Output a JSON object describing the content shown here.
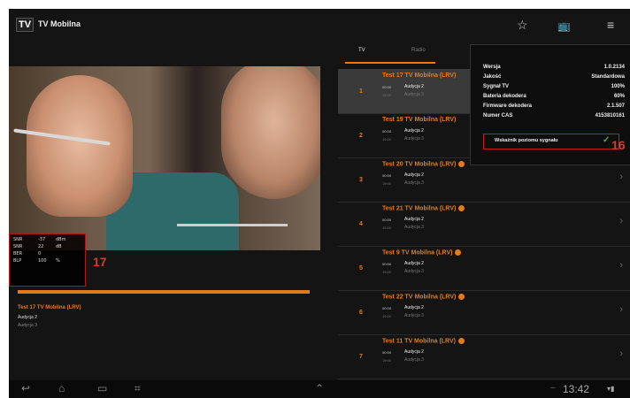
{
  "app": {
    "logo": "TV",
    "title": "TV Mobilna"
  },
  "actionbar": {
    "icons": [
      "star-icon",
      "tv-icon",
      "menu-icon"
    ]
  },
  "video": {
    "signal": {
      "rows": [
        {
          "label": "SNR",
          "value": "-37",
          "unit": "dBm"
        },
        {
          "label": "SNR",
          "value": "22",
          "unit": "dB"
        },
        {
          "label": "BER",
          "value": "0",
          "unit": ""
        },
        {
          "label": "BLP",
          "value": "100",
          "unit": "%"
        }
      ]
    },
    "progress": {
      "fraction": 1.0
    },
    "now_playing": {
      "title": "Test 17 TV Mobilna (LRV)",
      "line1": "Audycja 2",
      "line2": "Audycja 3"
    }
  },
  "annotations": {
    "label17": "17",
    "label16": "16"
  },
  "tabs": [
    {
      "label": "TV"
    },
    {
      "label": "Radio"
    }
  ],
  "channels": [
    {
      "num": "1",
      "name": "Test 17 TV Mobilna (LRV)",
      "badge": false,
      "time": "00:00",
      "prog": "Audycja 2",
      "time2": "19:00",
      "prog2": "Audycja 3",
      "selected": true
    },
    {
      "num": "2",
      "name": "Test 19 TV Mobilna (LRV)",
      "badge": false,
      "time": "00:00",
      "prog": "Audycja 2",
      "time2": "19:00",
      "prog2": "Audycja 3",
      "selected": false
    },
    {
      "num": "3",
      "name": "Test 20 TV Mobilna (LRV)",
      "badge": true,
      "time": "00:00",
      "prog": "Audycja 2",
      "time2": "19:00",
      "prog2": "Audycja 3",
      "selected": false
    },
    {
      "num": "4",
      "name": "Test 21 TV Mobilna (LRV)",
      "badge": true,
      "time": "00:00",
      "prog": "Audycja 2",
      "time2": "19:00",
      "prog2": "Audycja 3",
      "selected": false
    },
    {
      "num": "5",
      "name": "Test 9 TV Mobilna (LRV)",
      "badge": true,
      "time": "00:00",
      "prog": "Audycja 2",
      "time2": "19:00",
      "prog2": "Audycja 3",
      "selected": false
    },
    {
      "num": "6",
      "name": "Test 22 TV Mobilna (LRV)",
      "badge": true,
      "time": "00:00",
      "prog": "Audycja 2",
      "time2": "19:00",
      "prog2": "Audycja 3",
      "selected": false
    },
    {
      "num": "7",
      "name": "Test 11 TV Mobilna (LRV)",
      "badge": true,
      "time": "00:00",
      "prog": "Audycja 2",
      "time2": "19:00",
      "prog2": "Audycja 3",
      "selected": false
    }
  ],
  "popup": {
    "rows": [
      {
        "label": "Wersja",
        "value": "1.0.2134"
      },
      {
        "label": "Jakość",
        "value": "Standardowa"
      },
      {
        "label": "Sygnał TV",
        "value": "100%"
      },
      {
        "label": "Bateria dekodera",
        "value": "60%"
      },
      {
        "label": "Firmware dekodera",
        "value": "2.1.507"
      },
      {
        "label": "Numer CAS",
        "value": "4153810161"
      }
    ],
    "signal_button": "Wskaźnik poziomu sygnału"
  },
  "navbar": {
    "clock": "13:42"
  },
  "colors": {
    "accent": "#e27b1a",
    "annotation": "#d33c2c"
  }
}
